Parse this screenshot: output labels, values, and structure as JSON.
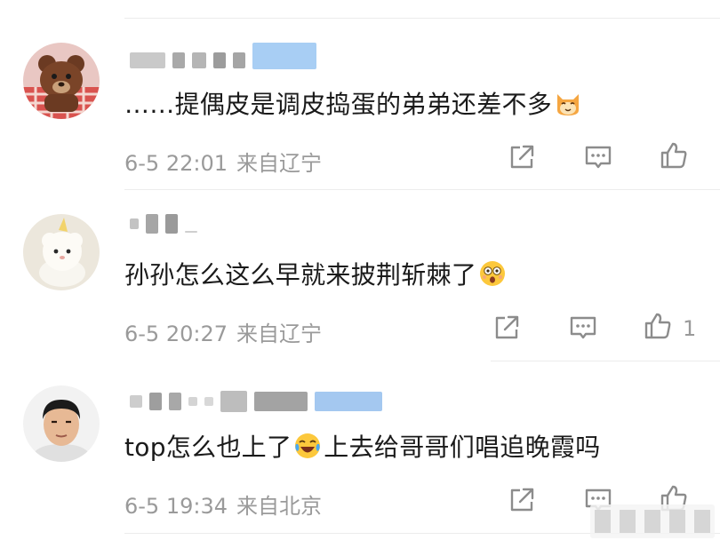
{
  "comments": [
    {
      "text": "……提偶皮是调皮捣蛋的弟弟还差不多",
      "emoji": "cat-face-emoji",
      "time": "6-5 22:01",
      "location": "来自辽宁",
      "like_count": ""
    },
    {
      "text": "孙孙怎么这么早就来披荆斩棘了",
      "emoji": "astonished-face-emoji",
      "time": "6-5 20:27",
      "location": "来自辽宁",
      "like_count": "1"
    },
    {
      "text": "top怎么也上了",
      "emoji": "crying-laughing-emoji",
      "text_after": "上去给哥哥们唱追晚霞吗",
      "time": "6-5 19:34",
      "location": "来自北京",
      "like_count": ""
    }
  ],
  "colors": {
    "meta_gray": "#9a9a9a",
    "text_dark": "#1a1a1a",
    "divider": "#ececec"
  }
}
